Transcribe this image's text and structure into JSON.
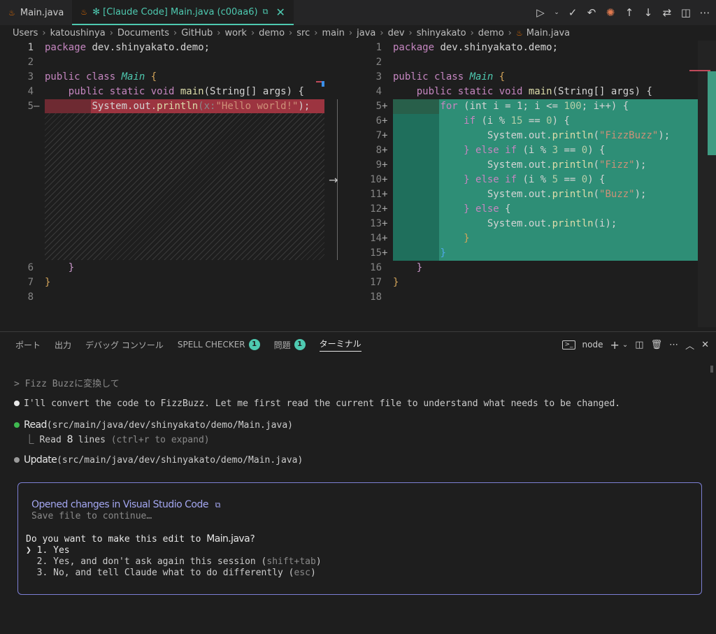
{
  "tabs": [
    {
      "label": "Main.java",
      "active": false
    },
    {
      "label": "✻ [Claude Code] Main.java (c00aa6)",
      "active": true
    }
  ],
  "breadcrumb": [
    "Users",
    "katoushinya",
    "Documents",
    "GitHub",
    "work",
    "demo",
    "src",
    "main",
    "java",
    "dev",
    "shinyakato",
    "demo",
    "Main.java"
  ],
  "left_editor": {
    "lines": [
      {
        "n": "1",
        "marker": ""
      },
      {
        "n": "2",
        "marker": ""
      },
      {
        "n": "3",
        "marker": ""
      },
      {
        "n": "4",
        "marker": ""
      },
      {
        "n": "5",
        "marker": "—"
      },
      {
        "n": "6",
        "marker": ""
      },
      {
        "n": "7",
        "marker": ""
      },
      {
        "n": "8",
        "marker": ""
      }
    ],
    "code": {
      "l1_kw": "package",
      "l1_rest": " dev.shinyakato.demo;",
      "l3_kw": "public class",
      "l3_cls": "Main",
      "l3_rest": " {",
      "l4_kw": "public static void",
      "l4_fn": "main",
      "l4_rest": "(String[] args) {",
      "l5_obj": "System.out.",
      "l5_fn": "println",
      "l5_hint": "(x:",
      "l5_str": "\"Hello world!\"",
      "l5_end": ");",
      "l6": "}",
      "l7": "}"
    }
  },
  "right_editor": {
    "lines": [
      {
        "n": "1",
        "marker": ""
      },
      {
        "n": "2",
        "marker": ""
      },
      {
        "n": "3",
        "marker": ""
      },
      {
        "n": "4",
        "marker": ""
      },
      {
        "n": "5",
        "marker": "+"
      },
      {
        "n": "6",
        "marker": "+"
      },
      {
        "n": "7",
        "marker": "+"
      },
      {
        "n": "8",
        "marker": "+"
      },
      {
        "n": "9",
        "marker": "+"
      },
      {
        "n": "10",
        "marker": "+"
      },
      {
        "n": "11",
        "marker": "+"
      },
      {
        "n": "12",
        "marker": "+"
      },
      {
        "n": "13",
        "marker": "+"
      },
      {
        "n": "14",
        "marker": "+"
      },
      {
        "n": "15",
        "marker": "+"
      },
      {
        "n": "16",
        "marker": ""
      },
      {
        "n": "17",
        "marker": ""
      },
      {
        "n": "18",
        "marker": ""
      }
    ],
    "code": {
      "l5_kw": "for",
      "l5_a": " (int i = 1; i <= ",
      "l5_num": "100",
      "l5_b": "; i++) {",
      "l6_kw": "if",
      "l6_a": " (i % ",
      "l6_num1": "15",
      "l6_b": " == ",
      "l6_num2": "0",
      "l6_c": ") {",
      "l7_obj": "System.out.",
      "l7_fn": "println",
      "l7_str": "\"FizzBuzz\"",
      "l8_kw": "} else if",
      "l8_a": " (i % ",
      "l8_num1": "3",
      "l8_b": " == ",
      "l8_num2": "0",
      "l8_c": ") {",
      "l9_str": "\"Fizz\"",
      "l10_num1": "5",
      "l11_str": "\"Buzz\"",
      "l12_kw": "} else",
      "l12_rest": " {",
      "l13_arg": "(i);",
      "l14": "}",
      "l15": "}"
    }
  },
  "panel": {
    "tabs": [
      {
        "label": "ポート",
        "badge": ""
      },
      {
        "label": "出力",
        "badge": ""
      },
      {
        "label": "デバッグ コンソール",
        "badge": ""
      },
      {
        "label": "SPELL CHECKER",
        "badge": "1"
      },
      {
        "label": "問題",
        "badge": "1"
      },
      {
        "label": "ターミナル",
        "badge": ""
      }
    ],
    "terminal_name": "node",
    "terminal_icon_text": ">_"
  },
  "terminal": {
    "user_prompt": "> Fizz Buzzに変換して",
    "assistant_msg": "I'll convert the code to FizzBuzz. Let me first read the current file to understand what needs to be changed.",
    "read_tool": "Read",
    "read_path": "(src/main/java/dev/shinyakato/demo/Main.java)",
    "read_result_a": "⎿ Read ",
    "read_result_n": "8",
    "read_result_b": " lines ",
    "read_result_hint": "(ctrl+r to expand)",
    "update_tool": "Update",
    "update_path": "(src/main/java/dev/shinyakato/demo/Main.java)"
  },
  "prompt_box": {
    "title": "Opened changes in Visual Studio Code",
    "subtitle": "Save file to continue…",
    "question_a": "Do you want to make this edit to ",
    "question_file": "Main.java",
    "question_b": "?",
    "opt1": "❯ 1. Yes",
    "opt2_a": "  2. Yes, and don't ask again this session (",
    "opt2_hint": "shift+tab",
    "opt2_b": ")",
    "opt3_a": "  3. No, and tell Claude what to do differently (",
    "opt3_hint": "esc",
    "opt3_b": ")"
  },
  "colors": {
    "accent": "#4ec9b0",
    "removed": "#9c3440",
    "added": "#2e8e76",
    "prompt_border": "#7c7fd4"
  }
}
